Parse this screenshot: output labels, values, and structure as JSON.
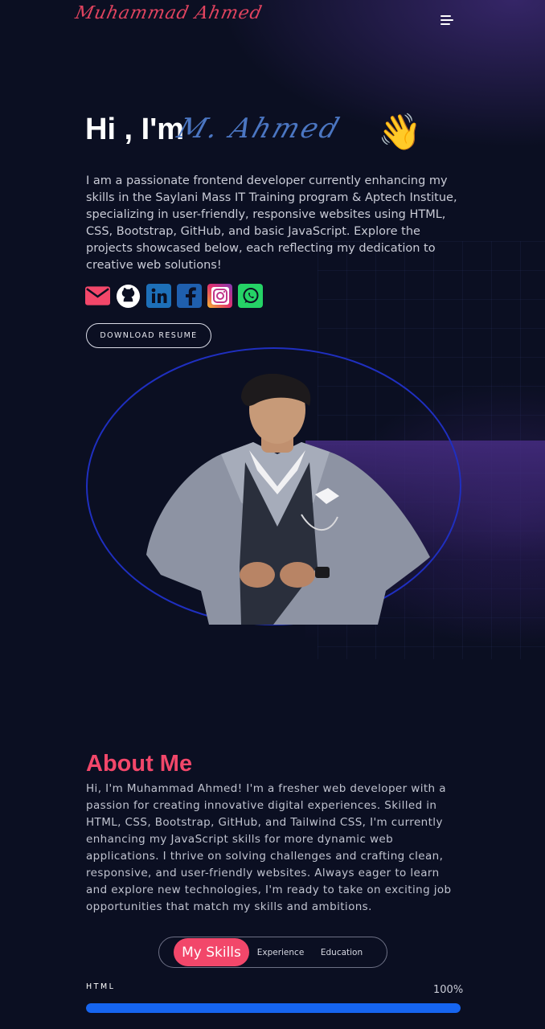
{
  "header": {
    "logo_text": "Muhammad Ahmed",
    "menu_icon": "hamburger-menu-icon"
  },
  "hero": {
    "greeting": "Hi , I'm",
    "name_signature": "M. Ahmed",
    "wave_emoji": "👋",
    "intro": "I am a passionate frontend developer currently enhancing my skills in the Saylani Mass IT Training program & Aptech Institue, specializing in user-friendly, responsive websites using HTML, CSS, Bootstrap, GitHub, and basic JavaScript. Explore the projects showcased below, each reflecting my dedication to creative web solutions!",
    "socials": [
      {
        "icon": "email-icon",
        "color": "#f2476a"
      },
      {
        "icon": "github-icon",
        "color": "#ffffff"
      },
      {
        "icon": "linkedin-icon",
        "color": "#1d6fb8"
      },
      {
        "icon": "facebook-icon",
        "color": "#1f5fae"
      },
      {
        "icon": "instagram-icon",
        "color": "#d6297a"
      },
      {
        "icon": "whatsapp-icon",
        "color": "#25d366"
      }
    ],
    "resume_button": "DOWNLOAD RESUME"
  },
  "about": {
    "title": "About Me",
    "text": "Hi, I'm Muhammad Ahmed! I'm a fresher web developer with a passion for creating innovative digital experiences. Skilled in HTML, CSS, Bootstrap, GitHub, and Tailwind CSS, I'm currently enhancing my JavaScript skills for more dynamic web applications. I thrive on solving challenges and crafting clean, responsive, and user-friendly websites. Always eager to learn and explore new technologies, I'm ready to take on exciting job opportunities that match my skills and ambitions."
  },
  "tabs": {
    "items": [
      "My Skills",
      "Experience",
      "Education"
    ],
    "active": "My Skills"
  },
  "skills": [
    {
      "name": "HTML",
      "value_label": "100%",
      "level": 1.0
    }
  ],
  "colors": {
    "accent": "#f2476a",
    "background": "#0b0f22",
    "skill_bar": "#1665f0",
    "ring": "#1f2fc0"
  }
}
